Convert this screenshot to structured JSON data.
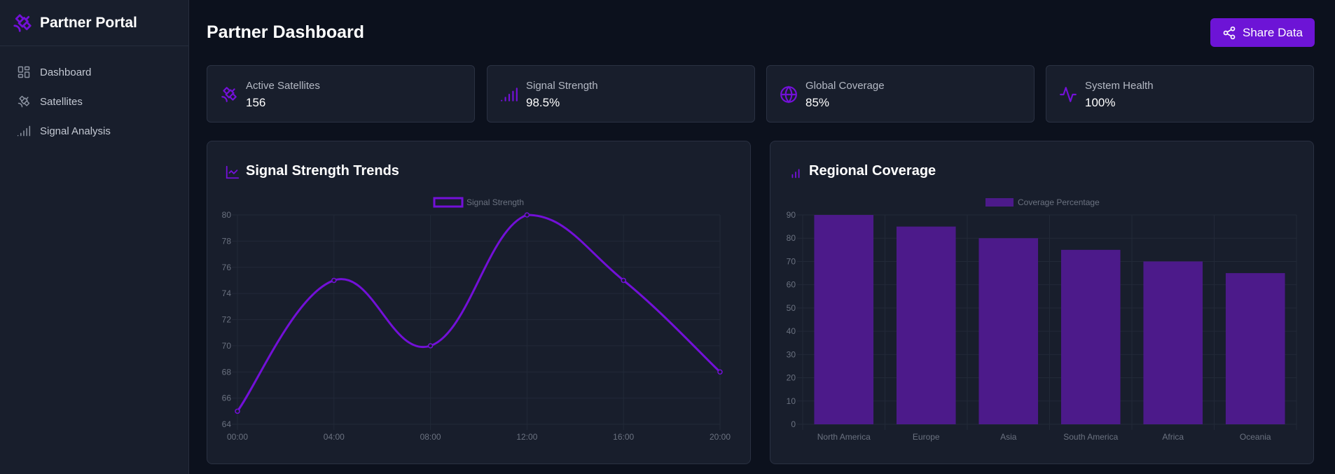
{
  "sidebar": {
    "brand": "Partner Portal",
    "items": [
      {
        "label": "Dashboard",
        "icon": "dashboard-icon"
      },
      {
        "label": "Satellites",
        "icon": "satellite-icon"
      },
      {
        "label": "Signal Analysis",
        "icon": "signal-icon"
      }
    ]
  },
  "header": {
    "title": "Partner Dashboard",
    "share_label": "Share Data"
  },
  "stats": [
    {
      "label": "Active Satellites",
      "value": "156",
      "icon": "satellite-icon"
    },
    {
      "label": "Signal Strength",
      "value": "98.5%",
      "icon": "signal-icon"
    },
    {
      "label": "Global Coverage",
      "value": "85%",
      "icon": "globe-icon"
    },
    {
      "label": "System Health",
      "value": "100%",
      "icon": "pulse-icon"
    }
  ],
  "colors": {
    "accent": "#6d14d6",
    "line": "#7310d8",
    "bar": "#4c1a8a",
    "background": "#0c111d",
    "card": "#181e2c"
  },
  "charts": {
    "signal_title": "Signal Strength Trends",
    "coverage_title": "Regional Coverage"
  },
  "chart_data": [
    {
      "type": "line",
      "title": "Signal Strength Trends",
      "x": [
        "00:00",
        "04:00",
        "08:00",
        "12:00",
        "16:00",
        "20:00"
      ],
      "series": [
        {
          "name": "Signal Strength",
          "values": [
            65,
            75,
            70,
            80,
            75,
            68
          ]
        }
      ],
      "ylim": [
        64,
        80
      ],
      "yticks": [
        64,
        66,
        68,
        70,
        72,
        74,
        76,
        78,
        80
      ],
      "legend": "top-center",
      "grid": true
    },
    {
      "type": "bar",
      "title": "Regional Coverage",
      "categories": [
        "North America",
        "Europe",
        "Asia",
        "South America",
        "Africa",
        "Oceania"
      ],
      "series": [
        {
          "name": "Coverage Percentage",
          "values": [
            90,
            85,
            80,
            75,
            70,
            65
          ]
        }
      ],
      "ylim": [
        0,
        90
      ],
      "yticks": [
        0,
        10,
        20,
        30,
        40,
        50,
        60,
        70,
        80,
        90
      ],
      "legend": "top-center",
      "grid": true
    }
  ]
}
